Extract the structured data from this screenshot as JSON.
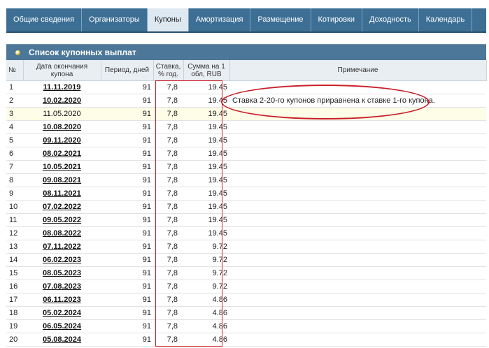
{
  "tabs": [
    {
      "label": "Общие сведения",
      "active": false
    },
    {
      "label": "Организаторы",
      "active": false
    },
    {
      "label": "Купоны",
      "active": true
    },
    {
      "label": "Амортизация",
      "active": false
    },
    {
      "label": "Размещение",
      "active": false
    },
    {
      "label": "Котировки",
      "active": false
    },
    {
      "label": "Доходность",
      "active": false
    },
    {
      "label": "Календарь",
      "active": false
    }
  ],
  "panel": {
    "title": "Список купонных выплат"
  },
  "table": {
    "headers": {
      "num": "№",
      "date": "Дата окончания купона",
      "period": "Период, дней",
      "rate": "Ставка, % год.",
      "sum": "Сумма на 1 обл, RUB",
      "note": "Примечание"
    },
    "rows": [
      {
        "num": "1",
        "date": "11.11.2019",
        "period": "91",
        "rate": "7,8",
        "sum": "19.45",
        "note": ""
      },
      {
        "num": "2",
        "date": "10.02.2020",
        "period": "91",
        "rate": "7,8",
        "sum": "19.45",
        "note": "Ставка 2-20-го купонов приравнена к ставке 1-го купона."
      },
      {
        "num": "3",
        "date": "11.05.2020",
        "period": "91",
        "rate": "7,8",
        "sum": "19.45",
        "note": ""
      },
      {
        "num": "4",
        "date": "10.08.2020",
        "period": "91",
        "rate": "7,8",
        "sum": "19.45",
        "note": ""
      },
      {
        "num": "5",
        "date": "09.11.2020",
        "period": "91",
        "rate": "7,8",
        "sum": "19.45",
        "note": ""
      },
      {
        "num": "6",
        "date": "08.02.2021",
        "period": "91",
        "rate": "7,8",
        "sum": "19.45",
        "note": ""
      },
      {
        "num": "7",
        "date": "10.05.2021",
        "period": "91",
        "rate": "7,8",
        "sum": "19.45",
        "note": ""
      },
      {
        "num": "8",
        "date": "09.08.2021",
        "period": "91",
        "rate": "7,8",
        "sum": "19.45",
        "note": ""
      },
      {
        "num": "9",
        "date": "08.11.2021",
        "period": "91",
        "rate": "7,8",
        "sum": "19.45",
        "note": ""
      },
      {
        "num": "10",
        "date": "07.02.2022",
        "period": "91",
        "rate": "7,8",
        "sum": "19.45",
        "note": ""
      },
      {
        "num": "11",
        "date": "09.05.2022",
        "period": "91",
        "rate": "7,8",
        "sum": "19.45",
        "note": ""
      },
      {
        "num": "12",
        "date": "08.08.2022",
        "period": "91",
        "rate": "7,8",
        "sum": "19.45",
        "note": ""
      },
      {
        "num": "13",
        "date": "07.11.2022",
        "period": "91",
        "rate": "7,8",
        "sum": "9.72",
        "note": ""
      },
      {
        "num": "14",
        "date": "06.02.2023",
        "period": "91",
        "rate": "7,8",
        "sum": "9.72",
        "note": ""
      },
      {
        "num": "15",
        "date": "08.05.2023",
        "period": "91",
        "rate": "7,8",
        "sum": "9.72",
        "note": ""
      },
      {
        "num": "16",
        "date": "07.08.2023",
        "period": "91",
        "rate": "7,8",
        "sum": "9.72",
        "note": ""
      },
      {
        "num": "17",
        "date": "06.11.2023",
        "period": "91",
        "rate": "7,8",
        "sum": "4.86",
        "note": ""
      },
      {
        "num": "18",
        "date": "05.02.2024",
        "period": "91",
        "rate": "7,8",
        "sum": "4.86",
        "note": ""
      },
      {
        "num": "19",
        "date": "06.05.2024",
        "period": "91",
        "rate": "7,8",
        "sum": "4.86",
        "note": ""
      },
      {
        "num": "20",
        "date": "05.08.2024",
        "period": "91",
        "rate": "7,8",
        "sum": "4.86",
        "note": ""
      }
    ],
    "highlighted_row": "3"
  },
  "annotations": {
    "color": "#c8202a"
  }
}
